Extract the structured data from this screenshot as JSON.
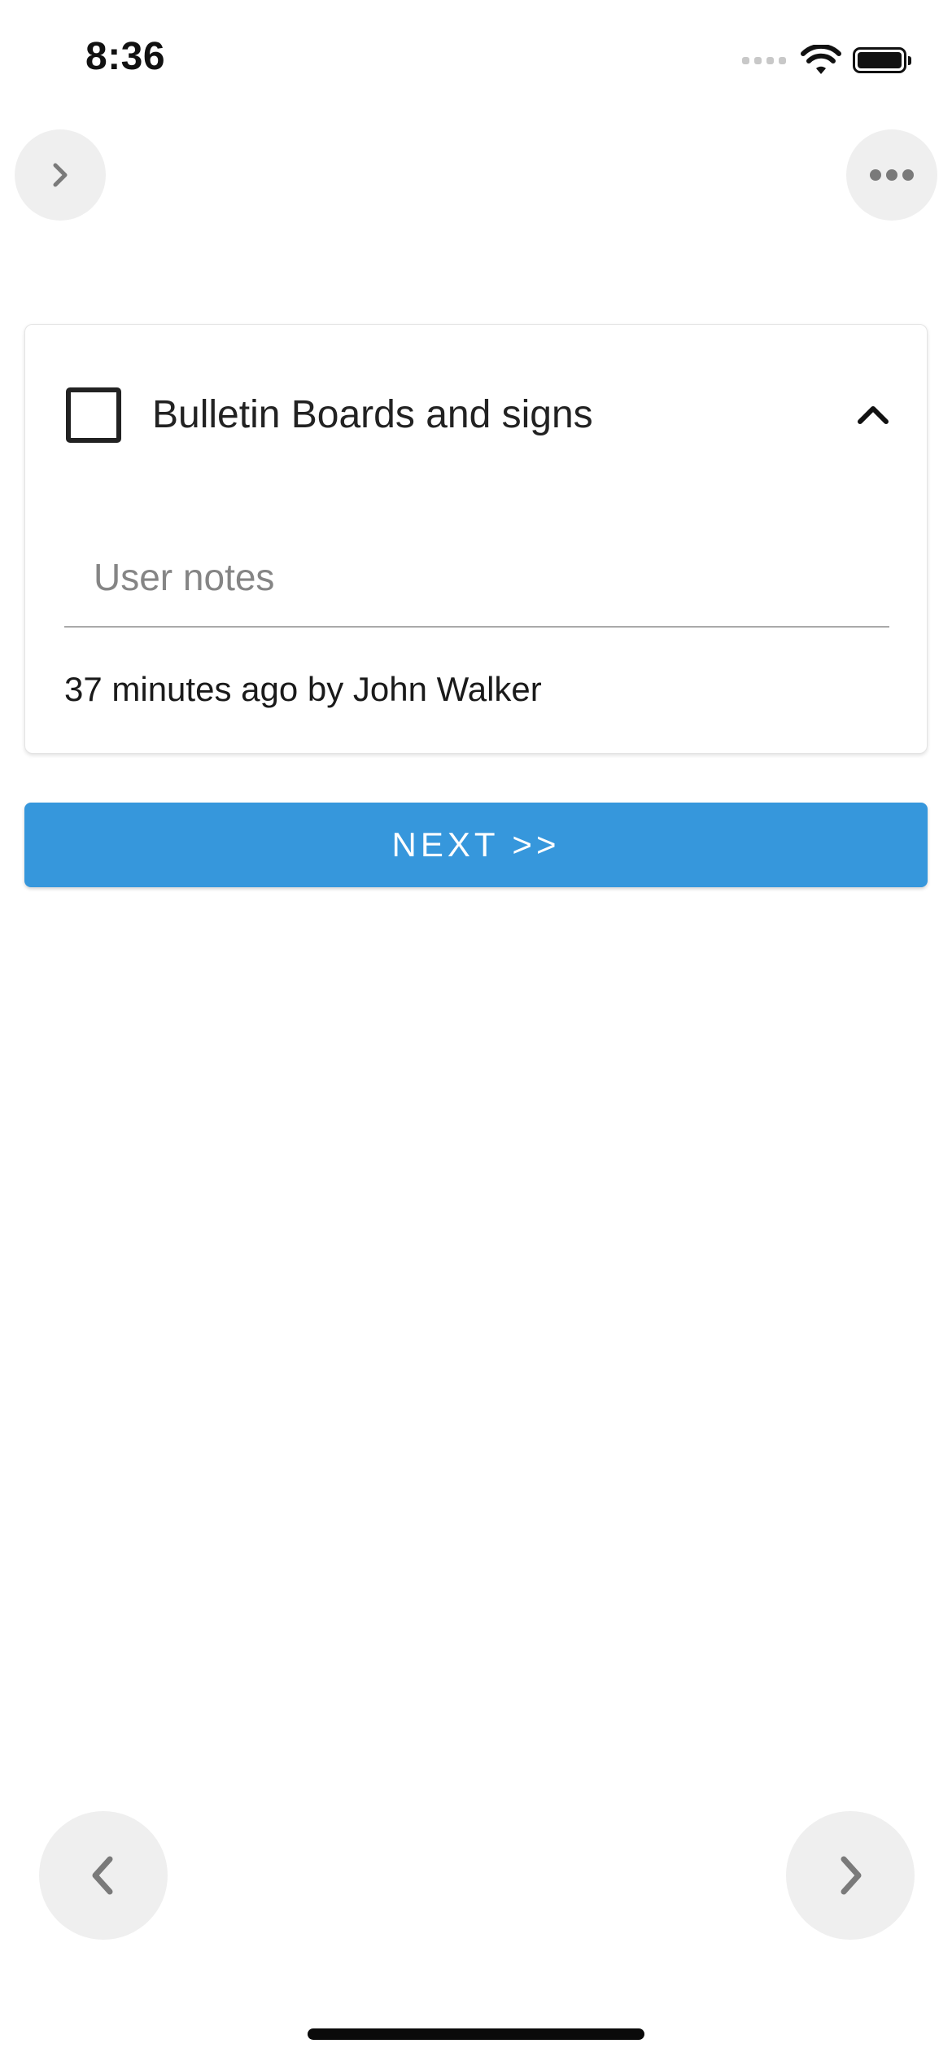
{
  "status_bar": {
    "time": "8:36",
    "icons": [
      "cellular-signal-icon",
      "wifi-icon",
      "battery-icon"
    ]
  },
  "toolbar": {
    "expand_icon": "chevron-right-icon",
    "more_icon": "more-horizontal-icon"
  },
  "checklist_item": {
    "title": "Bulletin Boards and signs",
    "checked": false,
    "expanded": true,
    "collapse_icon": "chevron-up-icon",
    "notes": {
      "value": "",
      "placeholder": "User notes"
    },
    "meta": "37 minutes ago by John Walker"
  },
  "next_button": {
    "label": "NEXT >>"
  },
  "pager": {
    "prev_icon": "chevron-left-icon",
    "next_icon": "chevron-right-icon"
  },
  "colors": {
    "accent": "#3697dc",
    "round_button_bg": "#efefef",
    "icon_gray": "#7a7a7a",
    "text": "#222222"
  }
}
